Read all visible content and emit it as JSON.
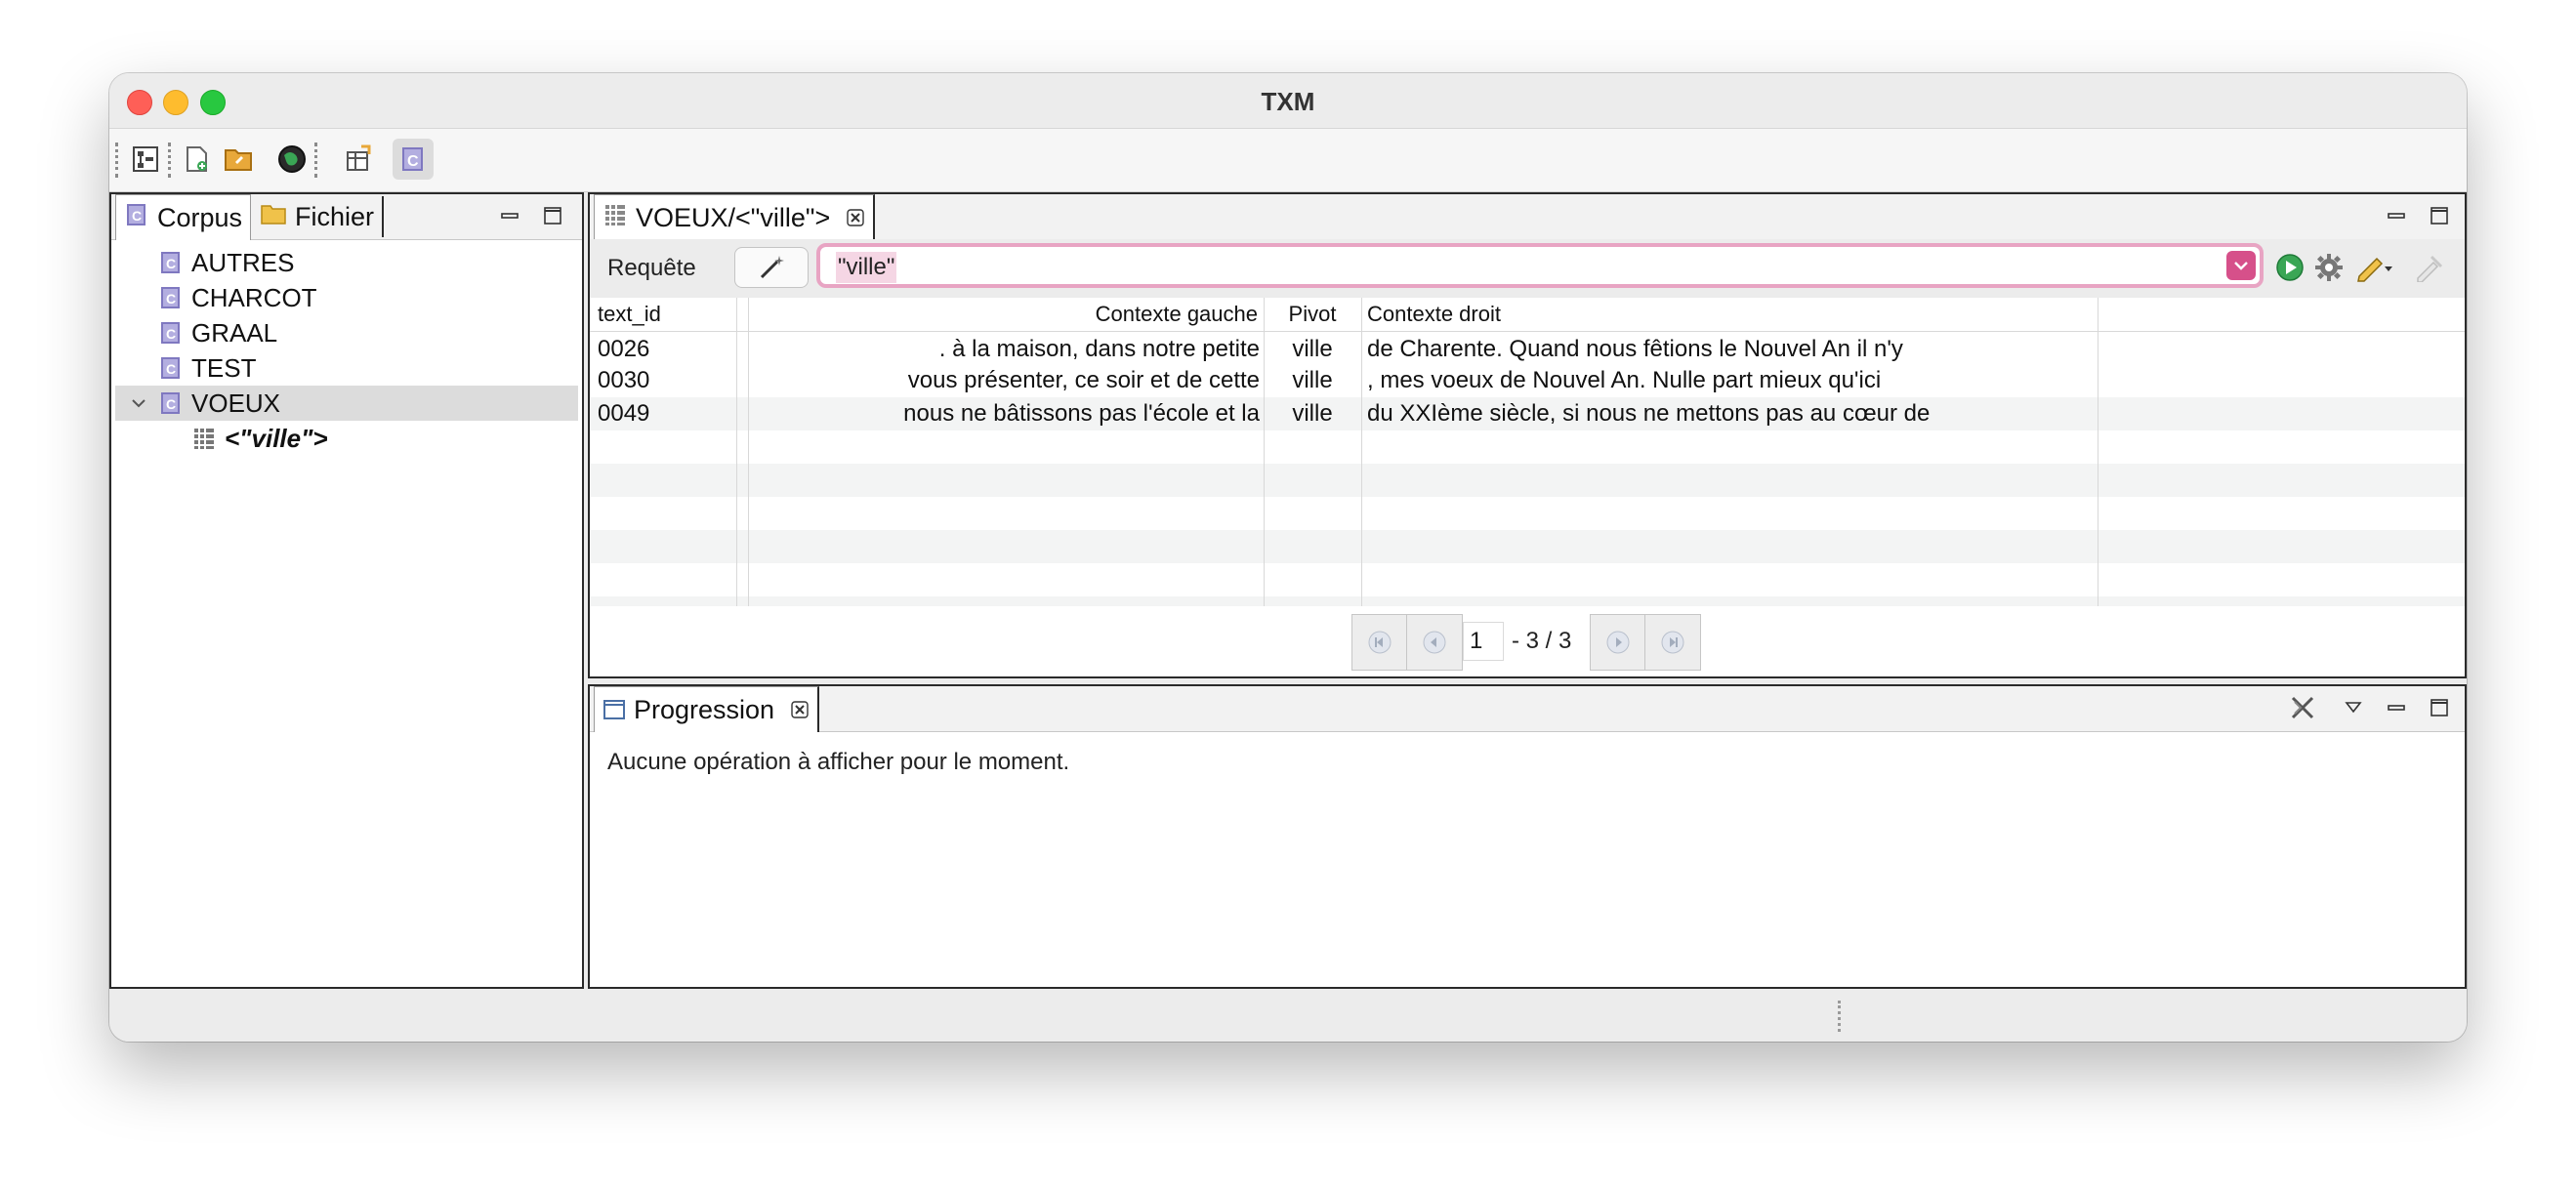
{
  "window": {
    "title": "TXM"
  },
  "left_view": {
    "tabs": [
      {
        "label": "Corpus",
        "icon": "corpus-icon"
      },
      {
        "label": "Fichier",
        "icon": "folder-icon"
      }
    ],
    "tree": [
      {
        "label": "AUTRES",
        "icon": "corpus-icon"
      },
      {
        "label": "CHARCOT",
        "icon": "corpus-icon"
      },
      {
        "label": "GRAAL",
        "icon": "corpus-icon"
      },
      {
        "label": "TEST",
        "icon": "corpus-icon"
      },
      {
        "label": "VOEUX",
        "icon": "corpus-icon",
        "expanded": true,
        "selected": true
      },
      {
        "label": "<\"ville\">",
        "icon": "concordance-icon"
      }
    ]
  },
  "concordance": {
    "tab_label": "VOEUX/<\"ville\">",
    "query_label": "Requête",
    "query_value": "\"ville\"",
    "columns": {
      "text_id": "text_id",
      "left": "Contexte gauche",
      "pivot": "Pivot",
      "right": "Contexte droit"
    },
    "rows": [
      {
        "text_id": "0026",
        "left": ". à la maison, dans notre petite",
        "pivot": "ville",
        "right": "de Charente. Quand nous fêtions le Nouvel An il n'y"
      },
      {
        "text_id": "0030",
        "left": "vous présenter, ce soir et de cette",
        "pivot": "ville",
        "right": ", mes voeux de Nouvel An. Nulle part mieux qu'ici"
      },
      {
        "text_id": "0049",
        "left": "nous ne bâtissons pas l'école et la",
        "pivot": "ville",
        "right": "du XXIème siècle, si nous ne mettons pas au cœur de"
      }
    ],
    "pager": {
      "page_value": "1",
      "range_text": "- 3 / 3"
    }
  },
  "progression": {
    "tab_label": "Progression",
    "message": "Aucune opération à afficher pour le moment."
  },
  "colors": {
    "query_border": "#e8a4c3",
    "query_dropdown": "#d6508a",
    "run_button": "#3aa655",
    "corpus_icon": "#8d86c9"
  }
}
